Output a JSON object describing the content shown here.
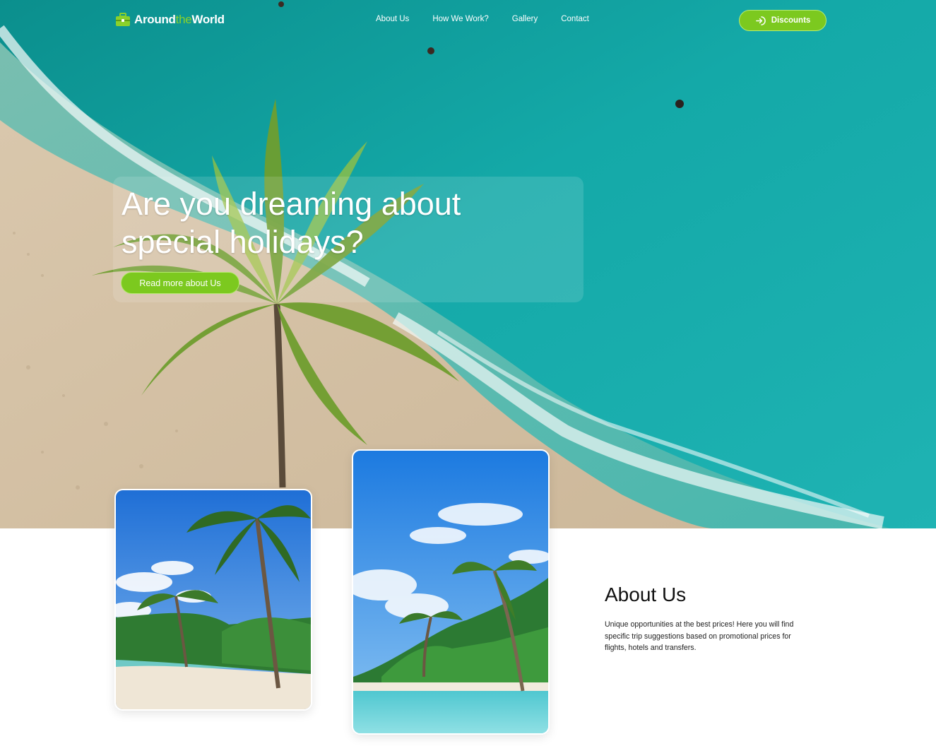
{
  "brand": {
    "name_part1": "Around",
    "name_part2": "the",
    "name_part3": "World",
    "logo_icon": "suitcase-icon",
    "accent_color": "#7cc91f"
  },
  "nav": {
    "links": [
      "About Us",
      "How We Work?",
      "Gallery",
      "Contact"
    ],
    "cta_label": "Discounts",
    "cta_icon": "login-arrow-icon"
  },
  "hero": {
    "title_line1": "Are you dreaming about",
    "title_line2": "special holidays?",
    "button_label": "Read more about Us"
  },
  "about": {
    "title": "About Us",
    "text": "Unique opportunities at the best prices! Here you will find specific trip suggestions based on promotional prices for flights, hotels and transfers."
  }
}
